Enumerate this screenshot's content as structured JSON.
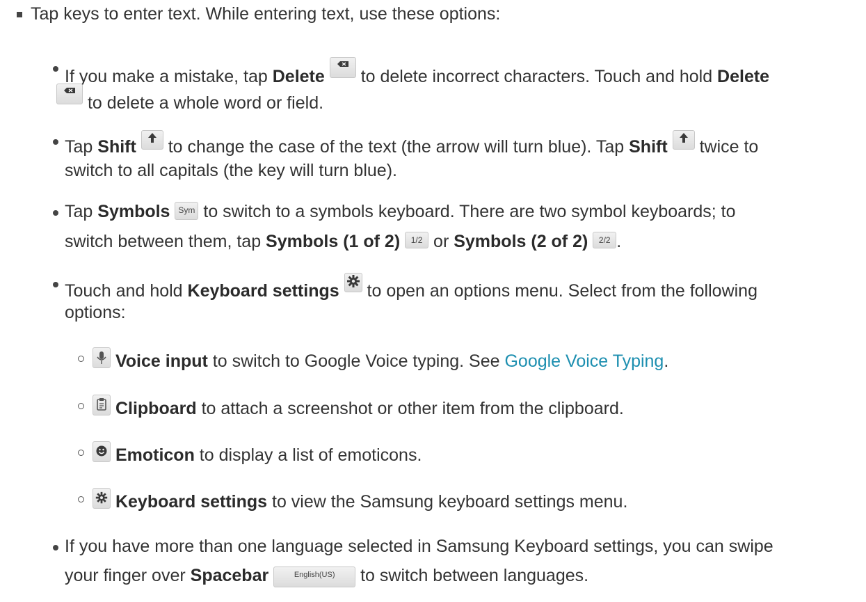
{
  "lines": {
    "l1": "Tap keys to enter text. While entering text, use these options:",
    "l2a": "If you make a mistake, tap ",
    "l2b": "Delete",
    "l2c": " to delete incorrect characters. Touch and hold ",
    "l2d": "Delete",
    "l3": "to delete a whole word or field.",
    "l4a": "Tap ",
    "l4b": "Shift",
    "l4c": " to change the case of the text (the arrow will turn blue). Tap ",
    "l4d": "Shift",
    "l4e": " twice to",
    "l5": "switch to all capitals (the key will turn blue).",
    "l6a": "Tap ",
    "l6b": "Symbols",
    "l6c": " to switch to a symbols keyboard. There are two symbol keyboards; to",
    "l7a": "switch between them, tap ",
    "l7b": "Symbols (1 of 2)",
    "l7c": " or ",
    "l7d": "Symbols (2 of 2)",
    "l7e": ".",
    "l8a": "Touch and hold ",
    "l8b": "Keyboard settings",
    "l8c": " to open an options menu. Select from the following",
    "l9": "options:",
    "l10a": "Voice input",
    "l10b": " to switch to Google Voice typing. See ",
    "l10c": "Google Voice Typing",
    "l10d": ".",
    "l11a": "Clipboard",
    "l11b": " to attach a screenshot or other item from the clipboard.",
    "l12a": "Emoticon",
    "l12b": " to display a list of emoticons.",
    "l13a": "Keyboard settings",
    "l13b": " to view the Samsung keyboard settings menu.",
    "l14": "If you have more than one language selected in Samsung Keyboard settings, you can swipe",
    "l15a": "your finger over ",
    "l15b": "Spacebar",
    "l15c": " to switch between languages."
  },
  "keys": {
    "sym": "Sym",
    "half1": "1/2",
    "half2": "2/2",
    "space": "English(US)"
  },
  "icons": {
    "delete": "backspace-icon",
    "shift": "shift-arrow-icon",
    "gear": "gear-icon",
    "mic": "microphone-icon",
    "clipboard": "clipboard-icon",
    "emoticon": "smiley-icon"
  },
  "colors": {
    "link": "#1d8fb0",
    "text": "#333333"
  }
}
